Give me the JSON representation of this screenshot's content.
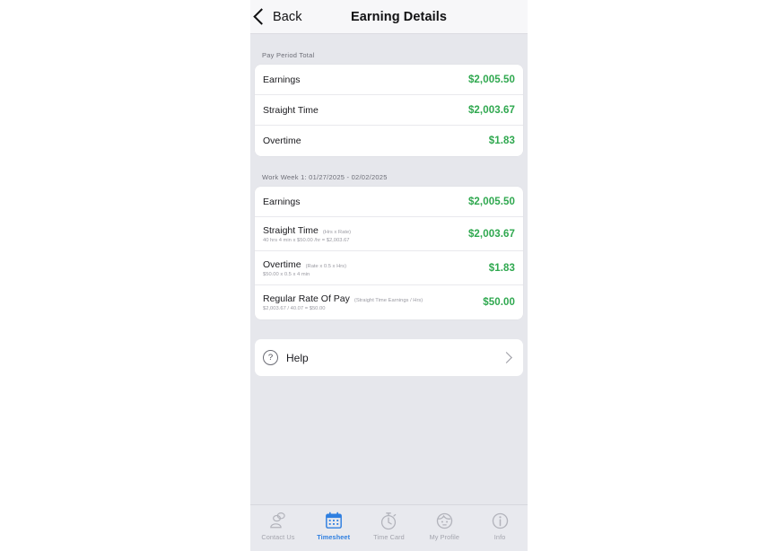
{
  "navbar": {
    "back_label": "Back",
    "title": "Earning Details",
    "back_icon": "chevron-left-icon"
  },
  "sections": [
    {
      "header": "Pay Period Total",
      "rows": [
        {
          "title": "Earnings",
          "formula": "",
          "sub": "",
          "amount": "$2,005.50"
        },
        {
          "title": "Straight Time",
          "formula": "",
          "sub": "",
          "amount": "$2,003.67"
        },
        {
          "title": "Overtime",
          "formula": "",
          "sub": "",
          "amount": "$1.83"
        }
      ]
    },
    {
      "header": "Work Week 1: 01/27/2025 - 02/02/2025",
      "rows": [
        {
          "title": "Earnings",
          "formula": "",
          "sub": "",
          "amount": "$2,005.50"
        },
        {
          "title": "Straight Time",
          "formula": "(Hrs x Rate)",
          "sub": "40 hrs 4 min x $50.00 /hr = $2,003.67",
          "amount": "$2,003.67"
        },
        {
          "title": "Overtime",
          "formula": "(Rate x 0.5 x Hrs)",
          "sub": "$50.00 x 0.5 x 4 min",
          "amount": "$1.83"
        },
        {
          "title": "Regular Rate Of Pay",
          "formula": "(Straight Time Earnings / Hrs)",
          "sub": "$2,003.67 / 40.07 = $50.00",
          "amount": "$50.00"
        }
      ]
    }
  ],
  "help": {
    "label": "Help",
    "icon": "question-circle-icon",
    "question_mark": "?",
    "chevron": "chevron-right-icon"
  },
  "tabbar": {
    "items": [
      {
        "label": "Contact Us",
        "icon": "contact-us-icon",
        "active": false
      },
      {
        "label": "Timesheet",
        "icon": "calendar-icon",
        "active": true
      },
      {
        "label": "Time Card",
        "icon": "stopwatch-icon",
        "active": false
      },
      {
        "label": "My Profile",
        "icon": "face-icon",
        "active": false
      },
      {
        "label": "Info",
        "icon": "info-circle-icon",
        "active": false
      }
    ]
  },
  "colors": {
    "amount_green": "#2fa84f",
    "active_blue": "#2f7fe0",
    "inactive_gray": "#a3a4ad",
    "page_bg": "#e6e7ec",
    "card_bg": "#ffffff"
  }
}
